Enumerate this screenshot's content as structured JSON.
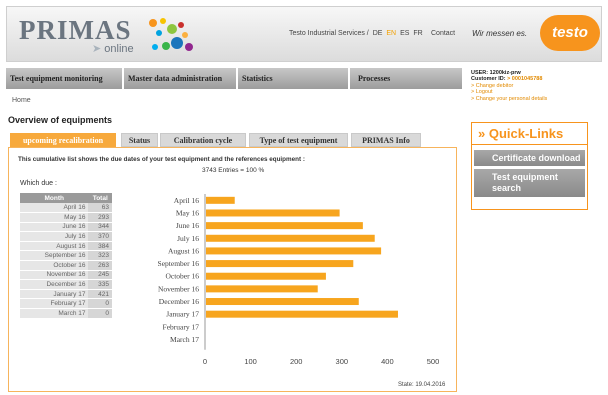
{
  "header": {
    "logo_word": "PRIMAS",
    "logo_sub": "online",
    "languages_prefix": "Testo Industrial Services / ",
    "languages": [
      "DE",
      "EN",
      "ES",
      "FR"
    ],
    "active_language": "EN",
    "contact": "Contact",
    "slogan": "Wir messen es.",
    "brand": "testo"
  },
  "nav": {
    "items": [
      "Test equipment monitoring",
      "Master data administration",
      "Statistics",
      "Processes"
    ]
  },
  "breadcrumb": "Home",
  "page_title": "Overview of equipments",
  "user": {
    "user_line": "USER: 1200kiz-prw",
    "customer_label": "Customer ID: ",
    "customer_id": "> 0001045788",
    "links": [
      "> Change debitor",
      "> Logout",
      "> Change your personal details"
    ]
  },
  "quick_links": {
    "title": "» Quick-Links",
    "buttons": [
      "Certificate download",
      "Test equipment search"
    ]
  },
  "tabs": [
    "upcoming recalibration",
    "Status",
    "Calibration cycle",
    "Type of test equipment",
    "PRIMAS Info"
  ],
  "active_tab": "upcoming recalibration",
  "description": "This cumulative list shows the due dates of your test equipment and the references equipment :",
  "entries": "3743 Entries = 100 %",
  "which_due": "Which due :",
  "table": {
    "headers": [
      "Month",
      "Total"
    ],
    "rows": [
      [
        "April 16",
        "63"
      ],
      [
        "May 16",
        "293"
      ],
      [
        "June 16",
        "344"
      ],
      [
        "July 16",
        "370"
      ],
      [
        "August 16",
        "384"
      ],
      [
        "September 16",
        "323"
      ],
      [
        "October 16",
        "263"
      ],
      [
        "November 16",
        "245"
      ],
      [
        "December 16",
        "335"
      ],
      [
        "January 17",
        "421"
      ],
      [
        "February 17",
        "0"
      ],
      [
        "March 17",
        "0"
      ]
    ]
  },
  "chart_data": {
    "type": "bar",
    "orientation": "horizontal",
    "categories": [
      "April 16",
      "May 16",
      "June 16",
      "July 16",
      "August 16",
      "September 16",
      "October 16",
      "November 16",
      "December 16",
      "January 17",
      "February 17",
      "March 17"
    ],
    "values": [
      63,
      293,
      344,
      370,
      384,
      323,
      263,
      245,
      335,
      421,
      0,
      0
    ],
    "xlim": [
      0,
      500
    ],
    "xticks": [
      0,
      100,
      200,
      300,
      400,
      500
    ],
    "bar_color": "#f7a51e"
  },
  "state": "State: 19.04.2016",
  "colors": {
    "accent": "#f7941d",
    "bar": "#f7a51e"
  }
}
